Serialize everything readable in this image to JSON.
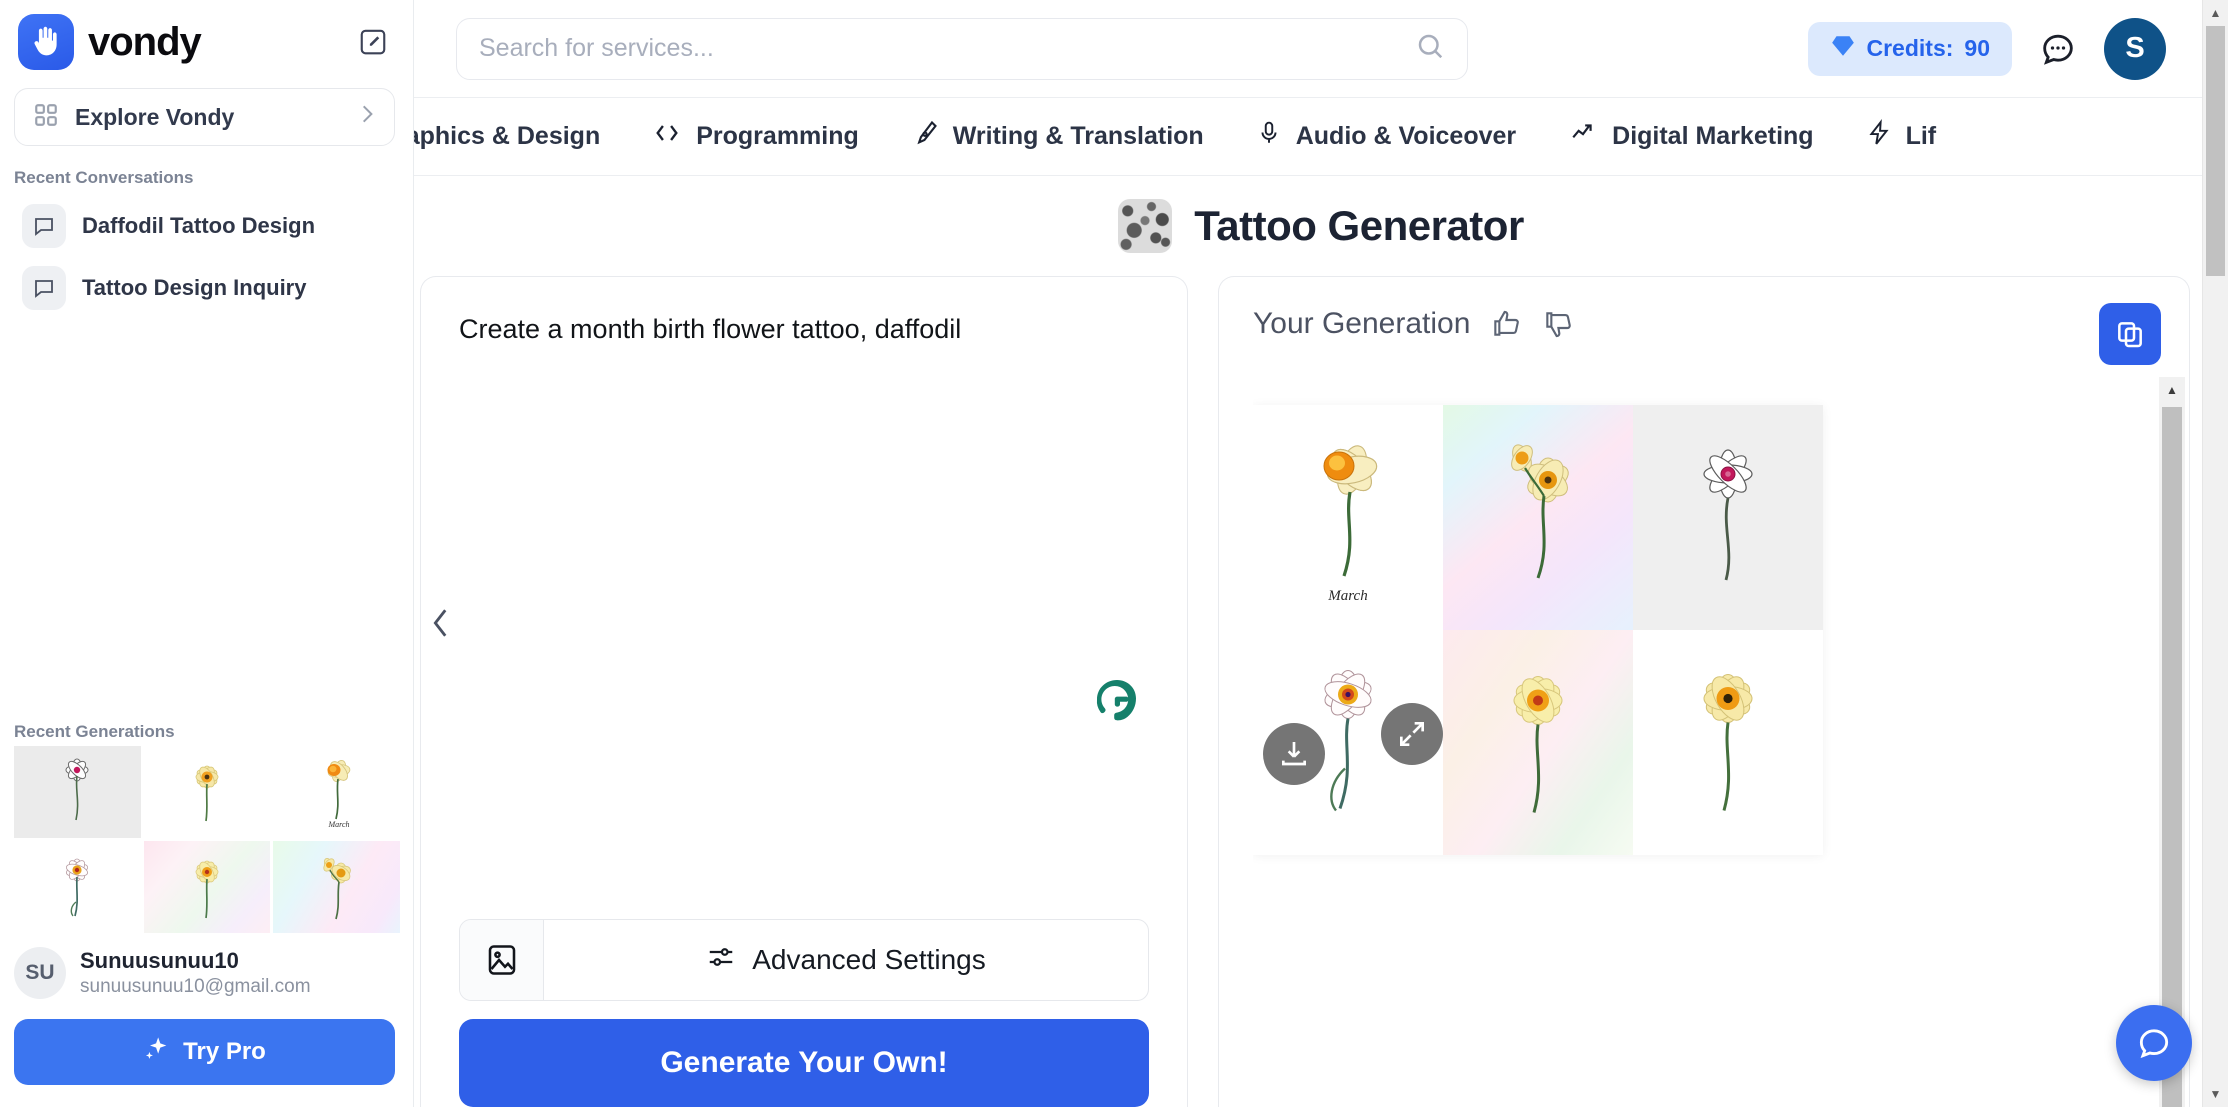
{
  "brand": {
    "name": "vondy",
    "logo_icon": "hand-wave-logo",
    "new_chat_icon": "edit-square-icon"
  },
  "sidebar": {
    "explore": {
      "label": "Explore Vondy",
      "icon": "grid-icon",
      "chevron": "chevron-right-icon"
    },
    "recent_conversations_label": "Recent Conversations",
    "conversations": [
      {
        "label": "Daffodil Tattoo Design",
        "icon": "chat-bubble-icon"
      },
      {
        "label": "Tattoo Design Inquiry",
        "icon": "chat-bubble-icon"
      }
    ],
    "recent_generations_label": "Recent Generations",
    "generations": [
      {
        "name": "white-line-daffodil-gray-bg",
        "style": "gray"
      },
      {
        "name": "yellow-daffodil-white-bg",
        "style": "plain"
      },
      {
        "name": "orange-daffodil-march-label",
        "style": "plain",
        "caption": "March"
      },
      {
        "name": "white-daffodil-sketch",
        "style": "plain"
      },
      {
        "name": "yellow-daffodil-pastel-bg",
        "style": "g1"
      },
      {
        "name": "double-daffodil-pastel-bg",
        "style": "g2"
      }
    ],
    "user": {
      "initials": "SU",
      "name": "Sunuusunuu10",
      "email": "sunuusunuu10@gmail.com"
    },
    "try_pro": {
      "label": "Try Pro",
      "icon": "sparkle-icon"
    }
  },
  "topbar": {
    "search": {
      "placeholder": "Search for services...",
      "value": "",
      "icon": "search-icon"
    },
    "credits": {
      "prefix": "Credits:",
      "value": "90",
      "icon": "diamond-icon"
    },
    "chat_icon": "chat-dots-icon",
    "avatar": {
      "initial": "S"
    }
  },
  "categories": [
    {
      "label": "raphics & Design",
      "icon": "palette-icon"
    },
    {
      "label": "Programming",
      "icon": "code-brackets-icon"
    },
    {
      "label": "Writing & Translation",
      "icon": "pen-nib-icon"
    },
    {
      "label": "Audio & Voiceover",
      "icon": "microphone-icon"
    },
    {
      "label": "Digital Marketing",
      "icon": "trend-up-icon"
    },
    {
      "label": "Lif",
      "icon": "lightning-bolt-icon"
    }
  ],
  "page": {
    "title": "Tattoo Generator",
    "icon": "tattoo-pattern-icon"
  },
  "prompt": {
    "text": "Create a month birth flower tattoo, daffodil",
    "grammarly_icon": "grammarly-icon",
    "prev_chevron": "chevron-left-icon",
    "image_button_icon": "image-icon",
    "advanced_settings_label": "Advanced Settings",
    "advanced_settings_icon": "sliders-icon",
    "generate_label": "Generate Your Own!"
  },
  "result": {
    "title": "Your Generation",
    "thumbs_up_icon": "thumbs-up-icon",
    "thumbs_down_icon": "thumbs-down-icon",
    "copy_icon": "copy-icon",
    "download_icon": "download-icon",
    "expand_icon": "expand-arrows-icon",
    "cells": [
      {
        "name": "orange-daffodil-march",
        "style": "plain",
        "caption": "March"
      },
      {
        "name": "double-daffodil-pastel",
        "style": "grad1",
        "caption": ""
      },
      {
        "name": "white-line-daffodil",
        "style": "gray",
        "caption": ""
      },
      {
        "name": "white-daffodil-sketch",
        "style": "plain",
        "caption": ""
      },
      {
        "name": "yellow-daffodil-pastel",
        "style": "grad2",
        "caption": ""
      },
      {
        "name": "yellow-daffodil-plain",
        "style": "plain",
        "caption": ""
      }
    ]
  },
  "floating": {
    "chat_icon": "chat-bubble-icon"
  }
}
